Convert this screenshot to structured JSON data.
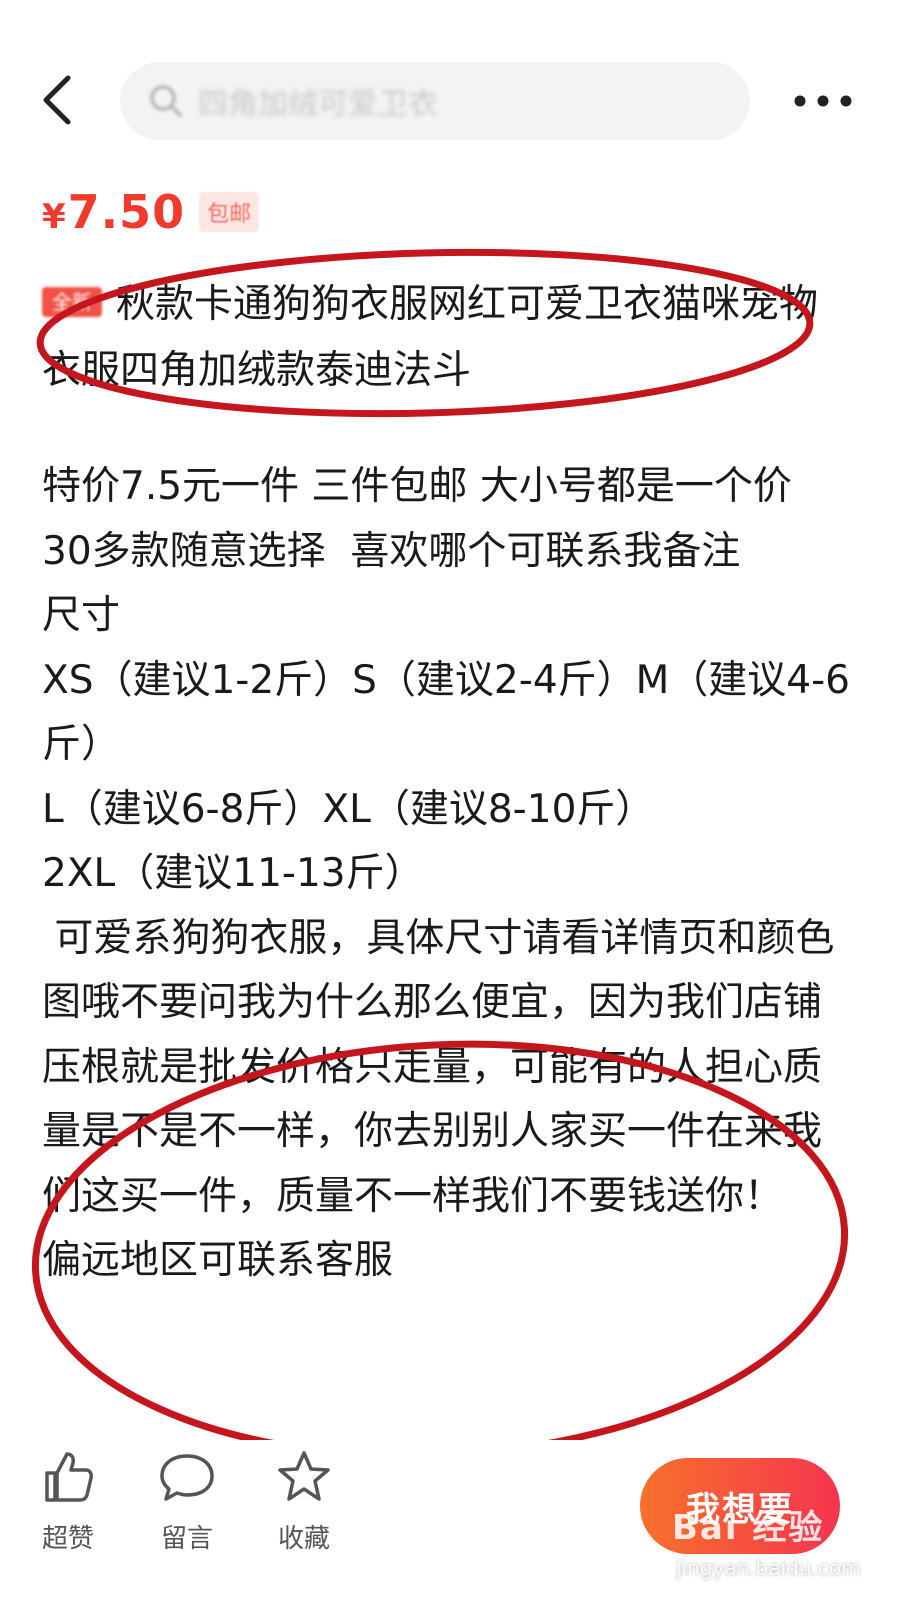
{
  "header": {
    "search_placeholder": "四角加绒可爱卫衣"
  },
  "product": {
    "price_symbol": "¥",
    "price": "7.50",
    "shipping_badge": "包邮",
    "new_badge": "全新",
    "title": "秋款卡通狗狗衣服网红可爱卫衣猫咪宠物衣服四角加绒款泰迪法斗"
  },
  "description": {
    "lines": [
      "特价7.5元一件 三件包邮 大小号都是一个价",
      "30多款随意选择  喜欢哪个可联系我备注",
      "尺寸",
      "XS（建议1-2斤）S（建议2-4斤）M（建议4-6斤）",
      "L（建议6-8斤）XL（建议8-10斤）",
      "2XL（建议11-13斤）",
      " 可爱系狗狗衣服，具体尺寸请看详情页和颜色图哦不要问我为什么那么便宜，因为我们店铺压根就是批发价格只走量，可能有的人担心质量是不是不一样，你去别别人家买一件在来我们这买一件，质量不一样我们不要钱送你！",
      "偏远地区可联系客服"
    ]
  },
  "bottom_bar": {
    "like_label": "超赞",
    "comment_label": "留言",
    "favorite_label": "收藏",
    "want_button": "我想要"
  },
  "watermark": {
    "logo_text": "Bai 经验",
    "url": "jingyan.baidu.com"
  },
  "colors": {
    "price_red": "#f23a2c",
    "annotation_red": "#c4161c",
    "want_gradient_start": "#f7712b",
    "want_gradient_end": "#f5354e"
  }
}
